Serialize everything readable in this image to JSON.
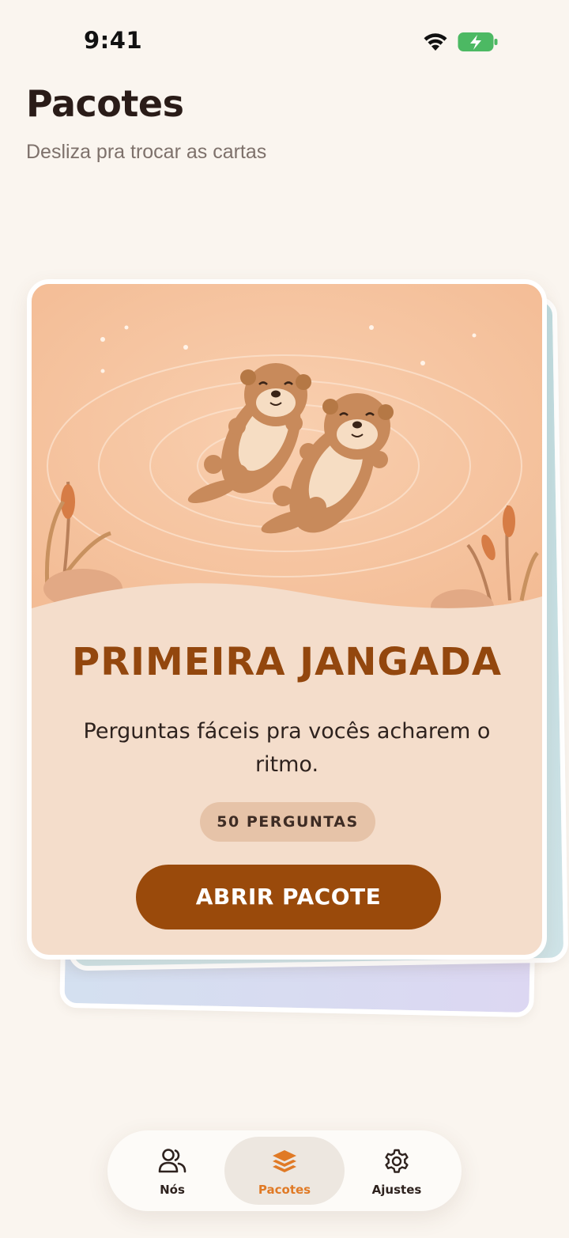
{
  "status_bar": {
    "time": "9:41"
  },
  "header": {
    "title": "Pacotes",
    "subtitle": "Desliza pra trocar as cartas"
  },
  "card": {
    "title": "PRIMEIRA JANGADA",
    "description": "Perguntas fáceis pra vocês acharem o ritmo.",
    "question_count": "50 PERGUNTAS",
    "open_button": "ABRIR PACOTE",
    "illustration": "otters-floating-icon"
  },
  "nav": {
    "items": [
      {
        "label": "Nós",
        "icon": "people-icon",
        "active": false
      },
      {
        "label": "Pacotes",
        "icon": "stack-icon",
        "active": true
      },
      {
        "label": "Ajustes",
        "icon": "gear-icon",
        "active": false
      }
    ]
  },
  "colors": {
    "background": "#FAF5EF",
    "accent": "#9A4A0B",
    "active_nav": "#E07A26",
    "card": "#F4DDCB"
  }
}
